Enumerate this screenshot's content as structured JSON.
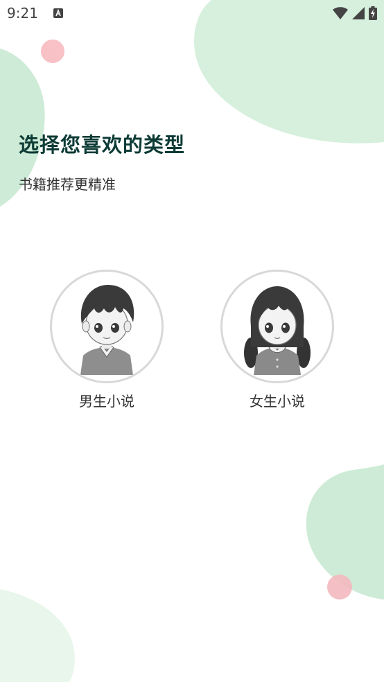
{
  "status_bar": {
    "time": "9:21",
    "notification_icon": "a-letter-icon",
    "icons": [
      "wifi-icon",
      "cellular-signal-icon",
      "battery-charging-icon"
    ]
  },
  "header": {
    "title": "选择您喜欢的类型",
    "subtitle": "书籍推荐更精准"
  },
  "options": [
    {
      "label": "男生小说",
      "icon": "boy-avatar"
    },
    {
      "label": "女生小说",
      "icon": "girl-avatar"
    }
  ],
  "colors": {
    "title": "#0d3b36",
    "blob_green": "#d1eed9",
    "blob_green_light": "#e8f6ec",
    "dot_pink": "#f7bcc2"
  }
}
